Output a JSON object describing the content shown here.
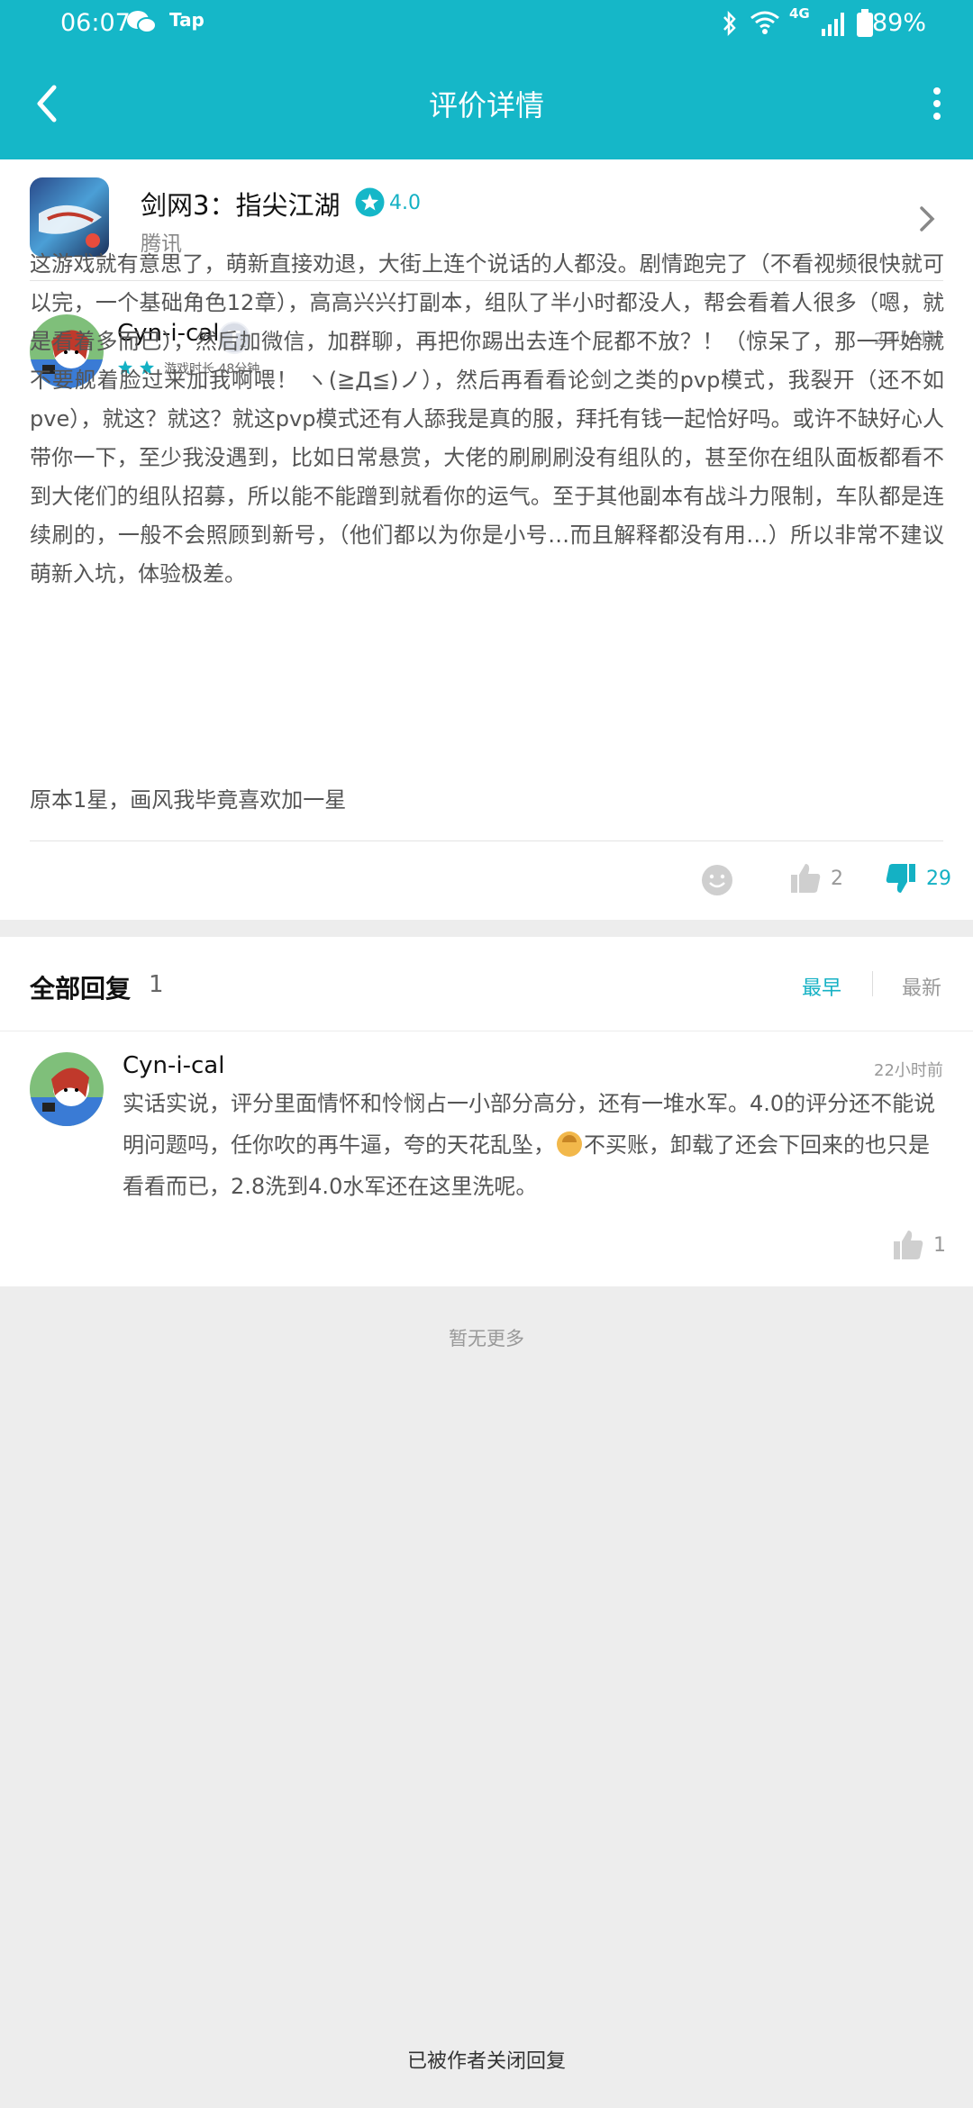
{
  "status": {
    "time": "06:07",
    "app_tag": "Tap",
    "battery": "89%",
    "network": "4G"
  },
  "nav": {
    "title": "评价详情"
  },
  "game": {
    "title": "剑网3：指尖江湖",
    "rating": "4.0",
    "publisher": "腾讯"
  },
  "review": {
    "username": "Cyn-i-cal",
    "badge": "T",
    "badge_level": "2",
    "stars": 2,
    "playtime": "游戏时长 48分钟",
    "time_ago": "23小时前",
    "text": "这游戏就有意思了，萌新直接劝退，大街上连个说话的人都没。剧情跑完了（不看视频很快就可以完，一个基础角色12章），高高兴兴打副本，组队了半小时都没人，帮会看着人很多（嗯，就是看着多而已），然后加微信，加群聊，再把你踢出去连个屁都不放？！（惊呆了，那一开始就不要舰着脸过来加我啊喂！ ヽ(≧Д≦)ノ），然后再看看论剑之类的pvp模式，我裂开（还不如pve），就这？就这？就这pvp模式还有人舔我是真的服，拜托有钱一起恰好吗。或许不缺好心人带你一下，至少我没遇到，比如日常悬赏，大佬的刷刷刷没有组队的，甚至你在组队面板都看不到大佬们的组队招募，所以能不能蹭到就看你的运气。至于其他副本有战斗力限制，车队都是连续刷的，一般不会照顾到新号，（他们都以为你是小号…而且解释都没有用…）所以非常不建议萌新入坑，体验极差。",
    "extra": "原本1星，画风我毕竟喜欢加一星",
    "likes": "2",
    "dislikes": "29"
  },
  "replies": {
    "title": "全部回复",
    "count": "1",
    "sort_earliest": "最早",
    "sort_latest": "最新",
    "items": [
      {
        "username": "Cyn-i-cal",
        "time_ago": "22小时前",
        "text_part1": "实话实说，评分里面情怀和怜悯占一小部分高分，还有一堆水军。4.0的评分还不能说明问题吗，任你吹的再牛逼，夸的天花乱坠，",
        "emoji": "emoji-face",
        "text_part2": "不买账，卸载了还会下回来的也只是看看而已，2.8洗到4.0水军还在这里洗呢。",
        "likes": "1"
      }
    ]
  },
  "footer": {
    "no_more": "暂无更多",
    "closed": "已被作者关闭回复"
  },
  "colors": {
    "accent": "#15b7c8",
    "star": "#14b1c4"
  }
}
